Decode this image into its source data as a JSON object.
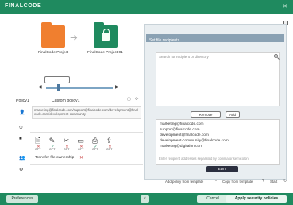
{
  "app": {
    "title": "FINALCODE",
    "controls": [
      "–",
      "✕"
    ]
  },
  "projects": {
    "source_label": "FinalCode Project",
    "dest_label": "FinalCode Project 01"
  },
  "policy": {
    "title": "Policy1",
    "name": "Custom policy1",
    "emails_text": "marketing@finalcode.com/support@finalcode.com/development@finalcode.com/development-community"
  },
  "permissions": {
    "labels": [
      "OPT",
      "OPT",
      "OPT",
      "OPT",
      "OPT",
      "OPT"
    ]
  },
  "transfer": {
    "label": "Transfer file ownership"
  },
  "recipients": {
    "header": "Set file recipients",
    "search_placeholder": "Search for recipient or directory",
    "remove_label": "Remove",
    "add_label": "Add",
    "list": [
      "marketing@finalcode.com",
      "support@finalcode.com",
      "development@finalcode.com",
      "development-community@finalcode.com",
      "marketing@digitaltm.com"
    ],
    "hint": "Enter recipient addresses separated by comma or semicolon",
    "edit_label": "EDIT"
  },
  "footer": {
    "add_from_template": "Add policy from template",
    "copy_from_template": "Copy from template",
    "start": "Start"
  },
  "buttons": {
    "preferences": "Preferences",
    "back": "<",
    "cancel": "Cancel",
    "apply": "Apply security policies"
  }
}
